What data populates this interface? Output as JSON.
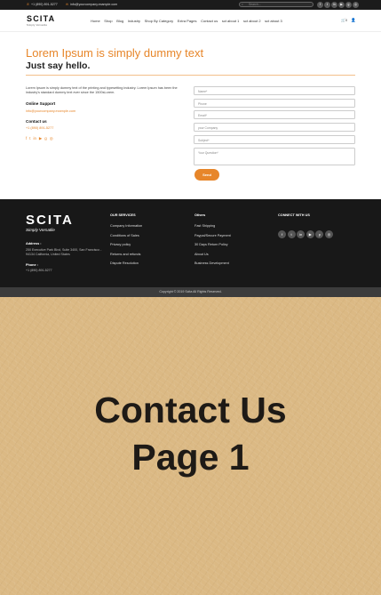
{
  "topbar": {
    "phone": "+1 (890) 891-5277",
    "email": "info@yourcompany.example.com",
    "search_placeholder": "Search...",
    "social_icons": [
      "facebook-icon",
      "twitter-icon",
      "linkedin-icon",
      "youtube-icon",
      "github-icon",
      "instagram-icon"
    ]
  },
  "header": {
    "logo": "SCITA",
    "logo_tagline": "Simply Versatile",
    "nav": [
      "Home",
      "Shop",
      "Blog",
      "Industry",
      "Shop By Category",
      "Extra Pages",
      "Contact us",
      "sct about 1",
      "sct about 2",
      "sct about 3"
    ],
    "cart_count": "0"
  },
  "main": {
    "title": "Lorem Ipsum is simply dummy text",
    "subtitle": "Just say hello.",
    "intro": "Lorem Ipsum is simply dummy text of the printing and typesetting industry. Lorem Ipsum has been the industry's standard dummy text ever since the 1500sLorem.",
    "online_support_label": "Online Support",
    "online_support_email": "info@yourcompany.example.com",
    "contact_label": "Contact us",
    "contact_phone": "+1 (890) 891-5277"
  },
  "form": {
    "name": "Name*",
    "phone": "Phone",
    "email": "Email*",
    "company": "your Company",
    "subject": "Subject*",
    "question": "Your Question*",
    "send": "Send"
  },
  "footer": {
    "logo": "SCITA",
    "logo_tagline": "Simply Versatile",
    "address_label": "Address :",
    "address": "250 Executive Park Blvd, Suite 3400, San Francisco - 94134 California, United States",
    "phone_label": "Phone :",
    "phone": "+1 (890) 891-5277",
    "services_head": "OUR SERVICES",
    "services": [
      "Company Information",
      "Conditions of Sales",
      "Privacy policy",
      "Returns and refunds",
      "Dispute Resolution"
    ],
    "others_head": "Others",
    "others": [
      "Fast Shipping",
      "Paypal/Secure Payment",
      "30 Days Return Policy",
      "About Us",
      "Business Development"
    ],
    "connect_head": "CONNECT WITH US",
    "social_icons": [
      "facebook-icon",
      "twitter-icon",
      "linkedin-icon",
      "youtube-icon",
      "pinterest-icon",
      "instagram-icon"
    ],
    "copyright": "Copyright © 2019 Scita All Rights Reserved."
  },
  "promo": {
    "line1": "Contact Us",
    "line2": "Page 1"
  },
  "colors": {
    "accent": "#e7862a",
    "footer_bg": "#181818",
    "promo_bg": "#dbb984"
  }
}
